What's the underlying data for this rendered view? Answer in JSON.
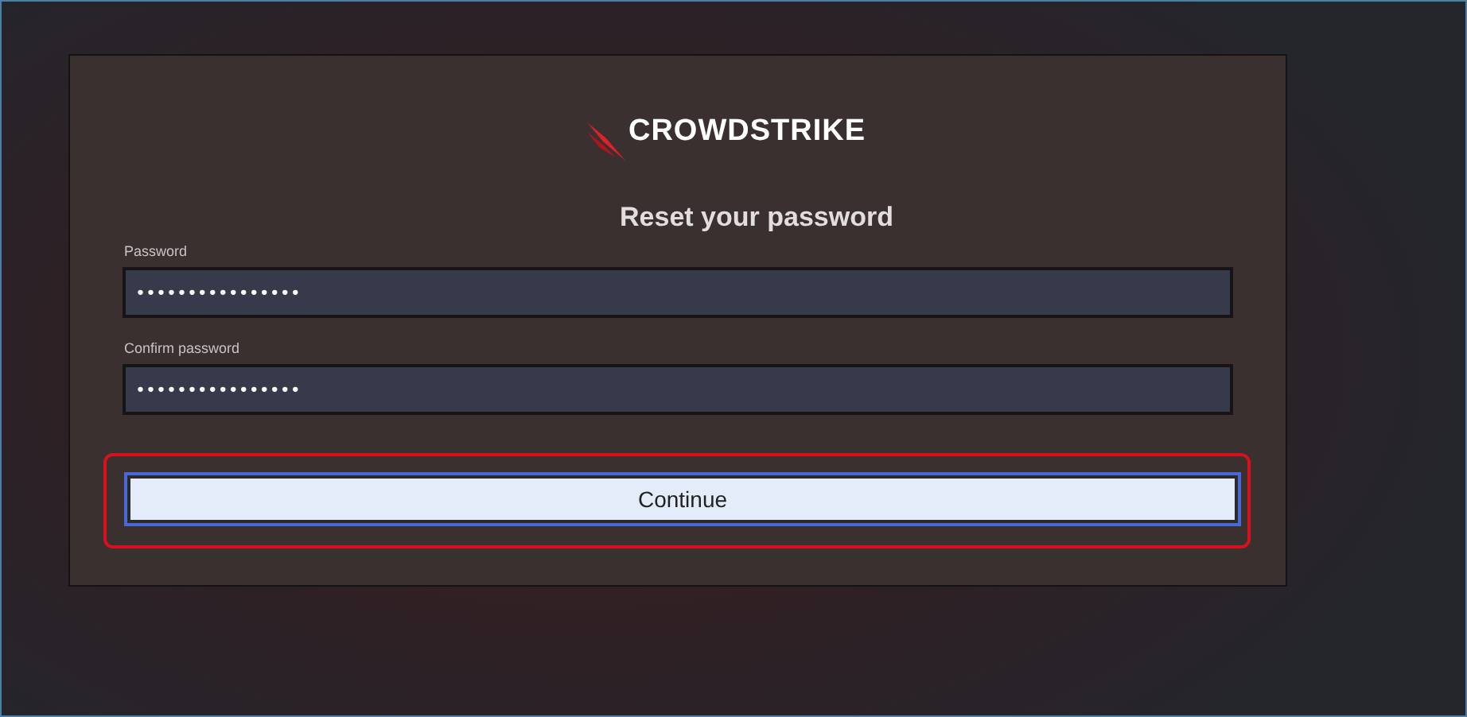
{
  "logo": {
    "text": "CROWDSTRIKE"
  },
  "title": "Reset your password",
  "fields": [
    {
      "label": "Password",
      "value": "••••••••••••••••"
    },
    {
      "label": "Confirm password",
      "value": "••••••••••••••••"
    }
  ],
  "button": {
    "label": "Continue",
    "highlighted": true,
    "focused": true
  }
}
